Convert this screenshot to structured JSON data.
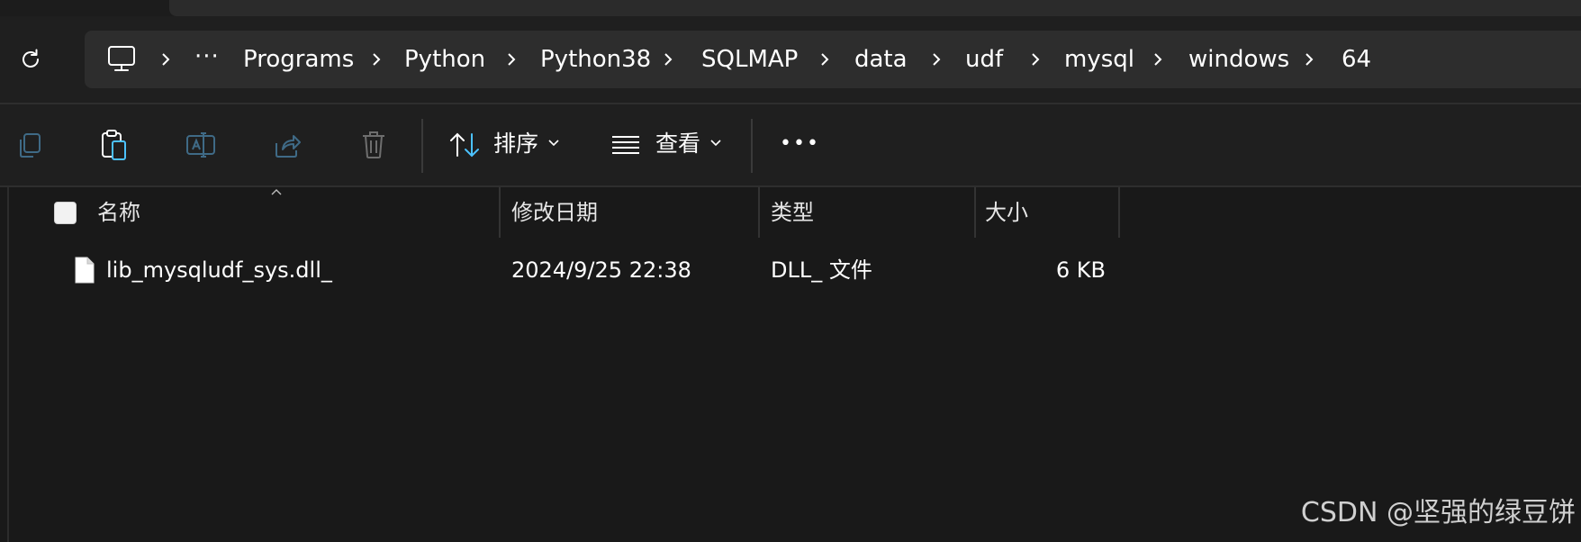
{
  "address": {
    "ellipsis": "···",
    "crumbs": [
      "Programs",
      "Python",
      "Python38",
      "SQLMAP",
      "data",
      "udf",
      "mysql",
      "windows",
      "64"
    ]
  },
  "commandbar": {
    "sort_label": "排序",
    "view_label": "查看",
    "more_label": "•••"
  },
  "columns": {
    "name": "名称",
    "date": "修改日期",
    "type": "类型",
    "size": "大小"
  },
  "files": [
    {
      "name": "lib_mysqludf_sys.dll_",
      "date": "2024/9/25 22:38",
      "type": "DLL_ 文件",
      "size": "6 KB"
    }
  ],
  "watermark": "CSDN @坚强的绿豆饼",
  "icons": {
    "refresh": "refresh-icon",
    "pc": "computer-icon",
    "copy": "copy-icon",
    "paste": "paste-icon",
    "rename": "rename-icon",
    "share": "share-icon",
    "delete": "delete-icon",
    "sort": "sort-arrows-icon",
    "view": "view-lines-icon",
    "file": "file-icon"
  },
  "colors": {
    "background": "#191919",
    "addressbar": "#2d2d2d",
    "accent": "#4cc2ff"
  }
}
